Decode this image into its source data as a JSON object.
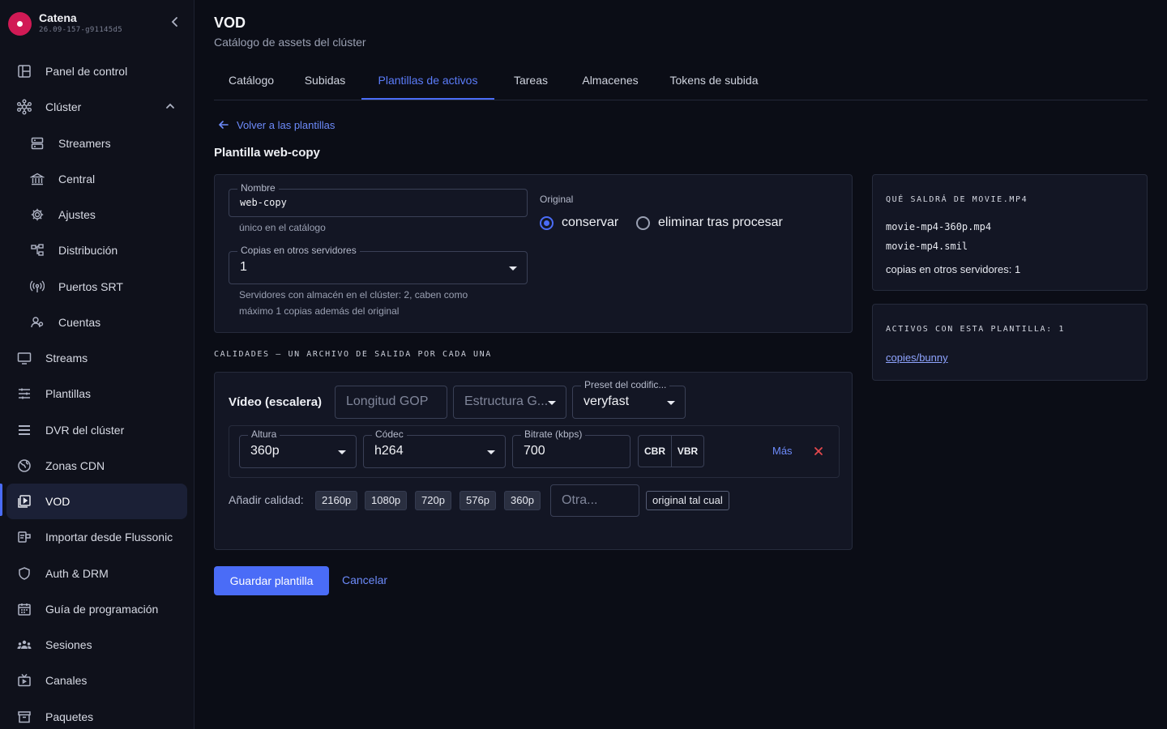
{
  "brand": {
    "name": "Catena",
    "version": "26.09-157-g91145d5"
  },
  "sidebar": {
    "items": [
      {
        "label": "Panel de control",
        "icon": "dashboard-icon"
      },
      {
        "label": "Clúster",
        "icon": "cluster-icon"
      },
      {
        "label": "Streamers",
        "icon": "server-icon"
      },
      {
        "label": "Central",
        "icon": "bank-icon"
      },
      {
        "label": "Ajustes",
        "icon": "gear-icon"
      },
      {
        "label": "Distribución",
        "icon": "distribution-icon"
      },
      {
        "label": "Puertos SRT",
        "icon": "broadcast-icon"
      },
      {
        "label": "Cuentas",
        "icon": "users-icon"
      },
      {
        "label": "Streams",
        "icon": "monitor-icon"
      },
      {
        "label": "Plantillas",
        "icon": "sliders-icon"
      },
      {
        "label": "DVR del clúster",
        "icon": "list-icon"
      },
      {
        "label": "Zonas CDN",
        "icon": "globe-icon"
      },
      {
        "label": "VOD",
        "icon": "vod-icon"
      },
      {
        "label": "Importar desde Flussonic",
        "icon": "import-icon"
      },
      {
        "label": "Auth & DRM",
        "icon": "shield-icon"
      },
      {
        "label": "Guía de programación",
        "icon": "calendar-icon"
      },
      {
        "label": "Sesiones",
        "icon": "group-icon"
      },
      {
        "label": "Canales",
        "icon": "tv-icon"
      },
      {
        "label": "Paquetes",
        "icon": "archive-icon"
      }
    ]
  },
  "header": {
    "title": "VOD",
    "subtitle": "Catálogo de assets del clúster"
  },
  "tabs": [
    "Catálogo",
    "Subidas",
    "Plantillas de activos",
    "Tareas",
    "Almacenes",
    "Tokens de subida"
  ],
  "back_link": "Volver a las plantillas",
  "section_title": "Plantilla web-copy",
  "form": {
    "name_label": "Nombre",
    "name_value": "web-copy",
    "name_helper": "único en el catálogo",
    "copies_label": "Copias en otros servidores",
    "copies_value": "1",
    "copies_helper": "Servidores con almacén en el clúster: 2, caben como máximo 1 copias además del original",
    "original_label": "Original",
    "radio_keep": "conservar",
    "radio_delete": "eliminar tras procesar"
  },
  "qualities": {
    "heading": "CALIDADES — UN ARCHIVO DE SALIDA POR CADA UNA",
    "video_label": "Vídeo (escalera)",
    "gop_placeholder": "Longitud GOP",
    "gop_structure_placeholder": "Estructura G...",
    "preset_label": "Preset del codific...",
    "preset_value": "veryfast",
    "row": {
      "height_label": "Altura",
      "height_value": "360p",
      "codec_label": "Códec",
      "codec_value": "h264",
      "bitrate_label": "Bitrate (kbps)",
      "bitrate_value": "700",
      "cbr": "CBR",
      "vbr": "VBR",
      "more": "Más"
    },
    "add_label": "Añadir calidad:",
    "presets": [
      "2160p",
      "1080p",
      "720p",
      "576p",
      "360p"
    ],
    "other_placeholder": "Otra...",
    "original_chip": "original tal cual"
  },
  "actions": {
    "save": "Guardar plantilla",
    "cancel": "Cancelar"
  },
  "preview": {
    "title": "QUÉ SALDRÁ DE MOVIE.MP4",
    "files": [
      "movie-mp4-360p.mp4",
      "movie-mp4.smil"
    ],
    "copies_line": "copias en otros servidores: 1"
  },
  "assets": {
    "title": "ACTIVOS CON ESTA PLANTILLA: 1",
    "link": "copies/bunny"
  },
  "colors": {
    "accent": "#4a6cf7",
    "brand": "#d11a55",
    "danger": "#e5484d"
  }
}
